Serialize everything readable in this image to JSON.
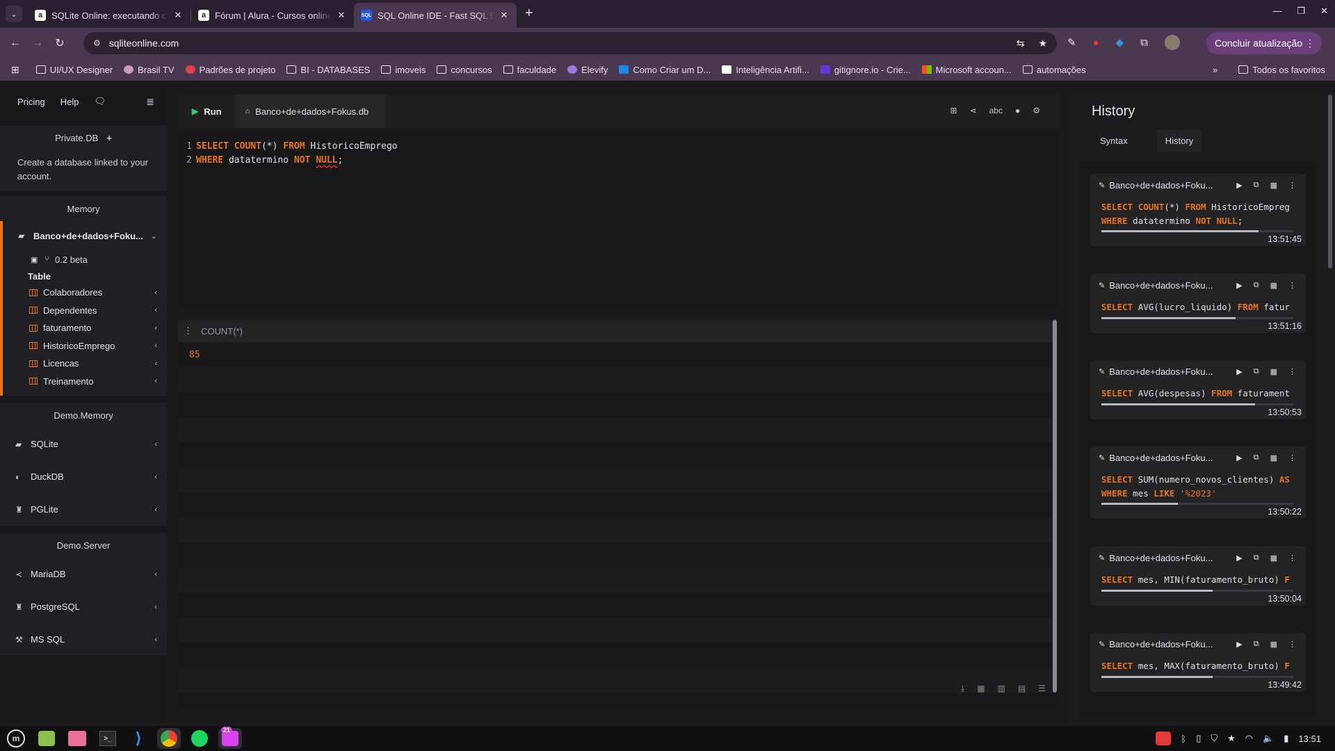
{
  "browser": {
    "tabs": [
      {
        "title": "SQLite Online: executando c",
        "favicon": "alura-icon"
      },
      {
        "title": "Fórum | Alura - Cursos online",
        "favicon": "alura-icon"
      },
      {
        "title": "SQL Online IDE - Fast SQL Ed",
        "favicon": "sqlonline-icon"
      }
    ],
    "url": "sqliteonline.com",
    "update_button": "Concluir atualização",
    "bookmarks": [
      "UI/UX Designer",
      "Brasil TV",
      "Padrões de projeto",
      "BI - DATABASES",
      "imoveis",
      "concursos",
      "faculdade",
      "Elevify",
      "Como Criar um D...",
      "Inteligência Artifi...",
      "gitignore.io - Crie...",
      "Microsoft accoun...",
      "automações"
    ],
    "bookmarks_all": "Todos os favoritos",
    "bookmarks_more": "»"
  },
  "sidebar": {
    "top_links": [
      "Pricing",
      "Help"
    ],
    "private_db": "Private.DB",
    "private_note": "Create a database linked to your account.",
    "memory_label": "Memory",
    "open_db": {
      "name": "Banco+de+dados+Foku...",
      "version": "0.2 beta",
      "table_header": "Table",
      "tables": [
        "Colaboradores",
        "Dependentes",
        "faturamento",
        "HistoricoEmprego",
        "Licencas",
        "Treinamento"
      ]
    },
    "demo_memory_label": "Demo.Memory",
    "demo_memory": [
      "SQLite",
      "DuckDB",
      "PGLite"
    ],
    "demo_server_label": "Demo.Server",
    "demo_server": [
      "MariaDB",
      "PostgreSQL",
      "MS SQL"
    ]
  },
  "editor": {
    "run_label": "Run",
    "file_tab": "Banco+de+dados+Fokus.db",
    "line_numbers": [
      "1",
      "2"
    ],
    "line1": {
      "k1": "SELECT",
      "k2": "COUNT",
      "t1": "(*) ",
      "k3": "FROM",
      "t2": " HistoricoEmprego"
    },
    "line2": {
      "k1": "WHERE",
      "t1": " datatermino ",
      "k2": "NOT",
      "t2": " ",
      "k3": "NULL",
      "t3": ";"
    }
  },
  "results": {
    "column": "COUNT(*)",
    "value": "85"
  },
  "history": {
    "title": "History",
    "tabs": [
      "Syntax",
      "History"
    ],
    "items": [
      {
        "db": "Banco+de+dados+Foku...",
        "line1": [
          [
            "k",
            "SELECT "
          ],
          [
            "k",
            "COUNT"
          ],
          [
            "t",
            "(*) "
          ],
          [
            "k",
            "FROM"
          ],
          [
            "t",
            " HistoricoEmpreg"
          ]
        ],
        "line2": [
          [
            "k",
            "WHERE"
          ],
          [
            "t",
            " datatermino "
          ],
          [
            "k",
            "NOT"
          ],
          [
            "t",
            " "
          ],
          [
            "k",
            "NULL"
          ],
          [
            "t",
            ";"
          ]
        ],
        "progress": 0.82,
        "time": "13:51:45"
      },
      {
        "db": "Banco+de+dados+Foku...",
        "line1": [
          [
            "k",
            "SELECT "
          ],
          [
            "t",
            "AVG(lucro_liquido) "
          ],
          [
            "k",
            "FROM"
          ],
          [
            "t",
            " fatur"
          ]
        ],
        "line2": [],
        "progress": 0.7,
        "time": "13:51:16"
      },
      {
        "db": "Banco+de+dados+Foku...",
        "line1": [
          [
            "k",
            "SELECT "
          ],
          [
            "t",
            "AVG(despesas) "
          ],
          [
            "k",
            "FROM"
          ],
          [
            "t",
            " faturament"
          ]
        ],
        "line2": [],
        "progress": 0.8,
        "time": "13:50:53"
      },
      {
        "db": "Banco+de+dados+Foku...",
        "line1": [
          [
            "k",
            "SELECT "
          ],
          [
            "t",
            "SUM(numero_novos_clientes) "
          ],
          [
            "k",
            "AS"
          ]
        ],
        "line2": [
          [
            "k",
            "WHERE"
          ],
          [
            "t",
            " mes "
          ],
          [
            "k",
            "LIKE"
          ],
          [
            "t",
            " "
          ],
          [
            "s",
            "'%2023'"
          ]
        ],
        "progress": 0.4,
        "time": "13:50:22"
      },
      {
        "db": "Banco+de+dados+Foku...",
        "line1": [
          [
            "k",
            "SELECT "
          ],
          [
            "t",
            "mes, MIN(faturamento_bruto) "
          ],
          [
            "k",
            "F"
          ]
        ],
        "line2": [],
        "progress": 0.58,
        "time": "13:50:04"
      },
      {
        "db": "Banco+de+dados+Foku...",
        "line1": [
          [
            "k",
            "SELECT "
          ],
          [
            "t",
            "mes, MAX(faturamento_bruto) "
          ],
          [
            "k",
            "F"
          ]
        ],
        "line2": [],
        "progress": 0.58,
        "time": "13:49:42"
      }
    ]
  },
  "taskbar": {
    "badge": "21",
    "clock": "13:51"
  },
  "colors": {
    "accent": "#e8741c",
    "run_green": "#2ecc71"
  }
}
